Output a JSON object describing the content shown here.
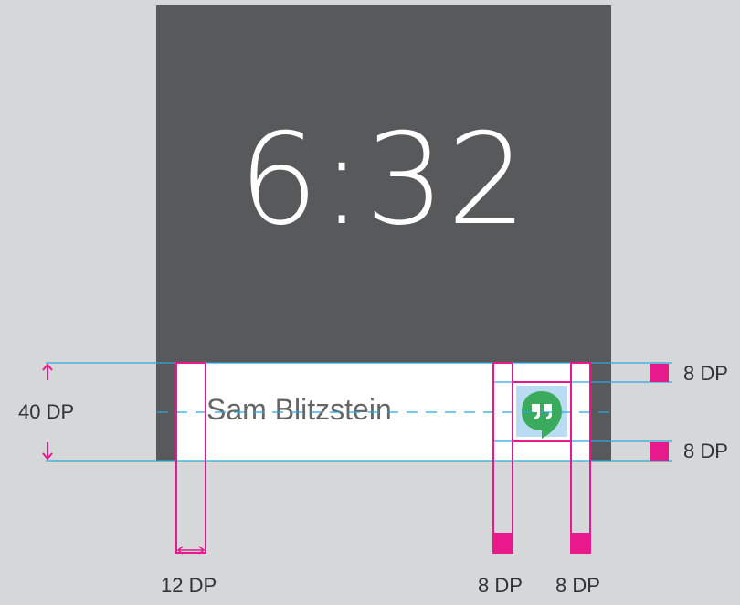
{
  "watch_face": {
    "time": "6:32"
  },
  "card": {
    "contact_name": "Sam Blitzstein",
    "app_icon": "hangouts-icon"
  },
  "annotations": {
    "card_height": "40 DP",
    "left_padding": "12 DP",
    "icon_top_margin": "8 DP",
    "icon_bottom_margin": "8 DP",
    "icon_left_margin": "8 DP",
    "icon_right_margin": "8 DP"
  },
  "colors": {
    "background": "#d6d7d9",
    "watch_face": "#58595b",
    "card": "#ffffff",
    "guide_line": "#29a8e0",
    "measure_mark": "#e8198b",
    "icon_green": "#3aaa5c",
    "icon_highlight": "#b9dcf3"
  }
}
